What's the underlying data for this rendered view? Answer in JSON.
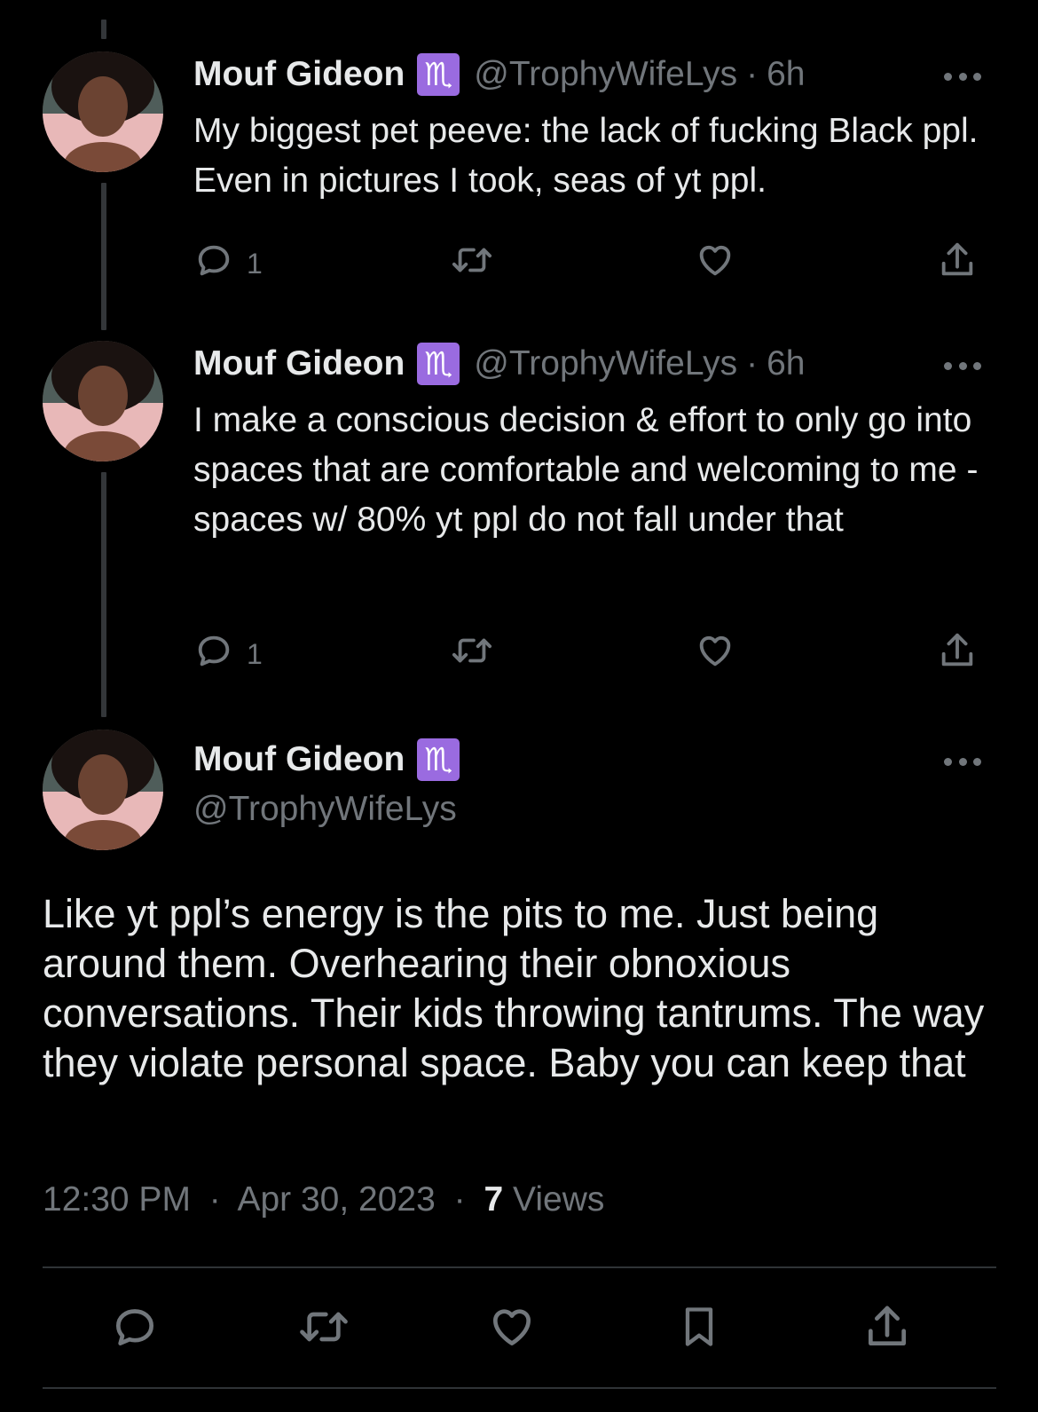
{
  "author": {
    "name": "Mouf Gideon",
    "badge": "♏",
    "handle": "@TrophyWifeLys"
  },
  "tweets": [
    {
      "time": "6h",
      "text": "My biggest pet peeve: the lack of fucking Black ppl. Even in pictures I took, seas of yt ppl.",
      "reply_count": "1"
    },
    {
      "time": "6h",
      "text": "I make a conscious decision & effort to only go into spaces that are comfortable and welcoming to me - spaces w/ 80% yt ppl do not fall under that",
      "reply_count": "1"
    }
  ],
  "main_tweet": {
    "text": "Like yt ppl’s energy is the pits to me. Just being around them. Overhearing their obnoxious conversations. Their kids throwing tantrums. The way they violate personal space. Baby you can keep that",
    "time": "12:30 PM",
    "date": "Apr 30, 2023",
    "views_count": "7",
    "views_label": "Views"
  },
  "separator": "·",
  "colors": {
    "background": "#000000",
    "text": "#e7e9ea",
    "muted": "#71767b",
    "badge": "#9a6be0",
    "thread_line": "#333639"
  },
  "icons": {
    "reply": "reply-icon",
    "retweet": "retweet-icon",
    "like": "heart-icon",
    "share": "share-icon",
    "bookmark": "bookmark-icon",
    "more": "more-icon"
  }
}
